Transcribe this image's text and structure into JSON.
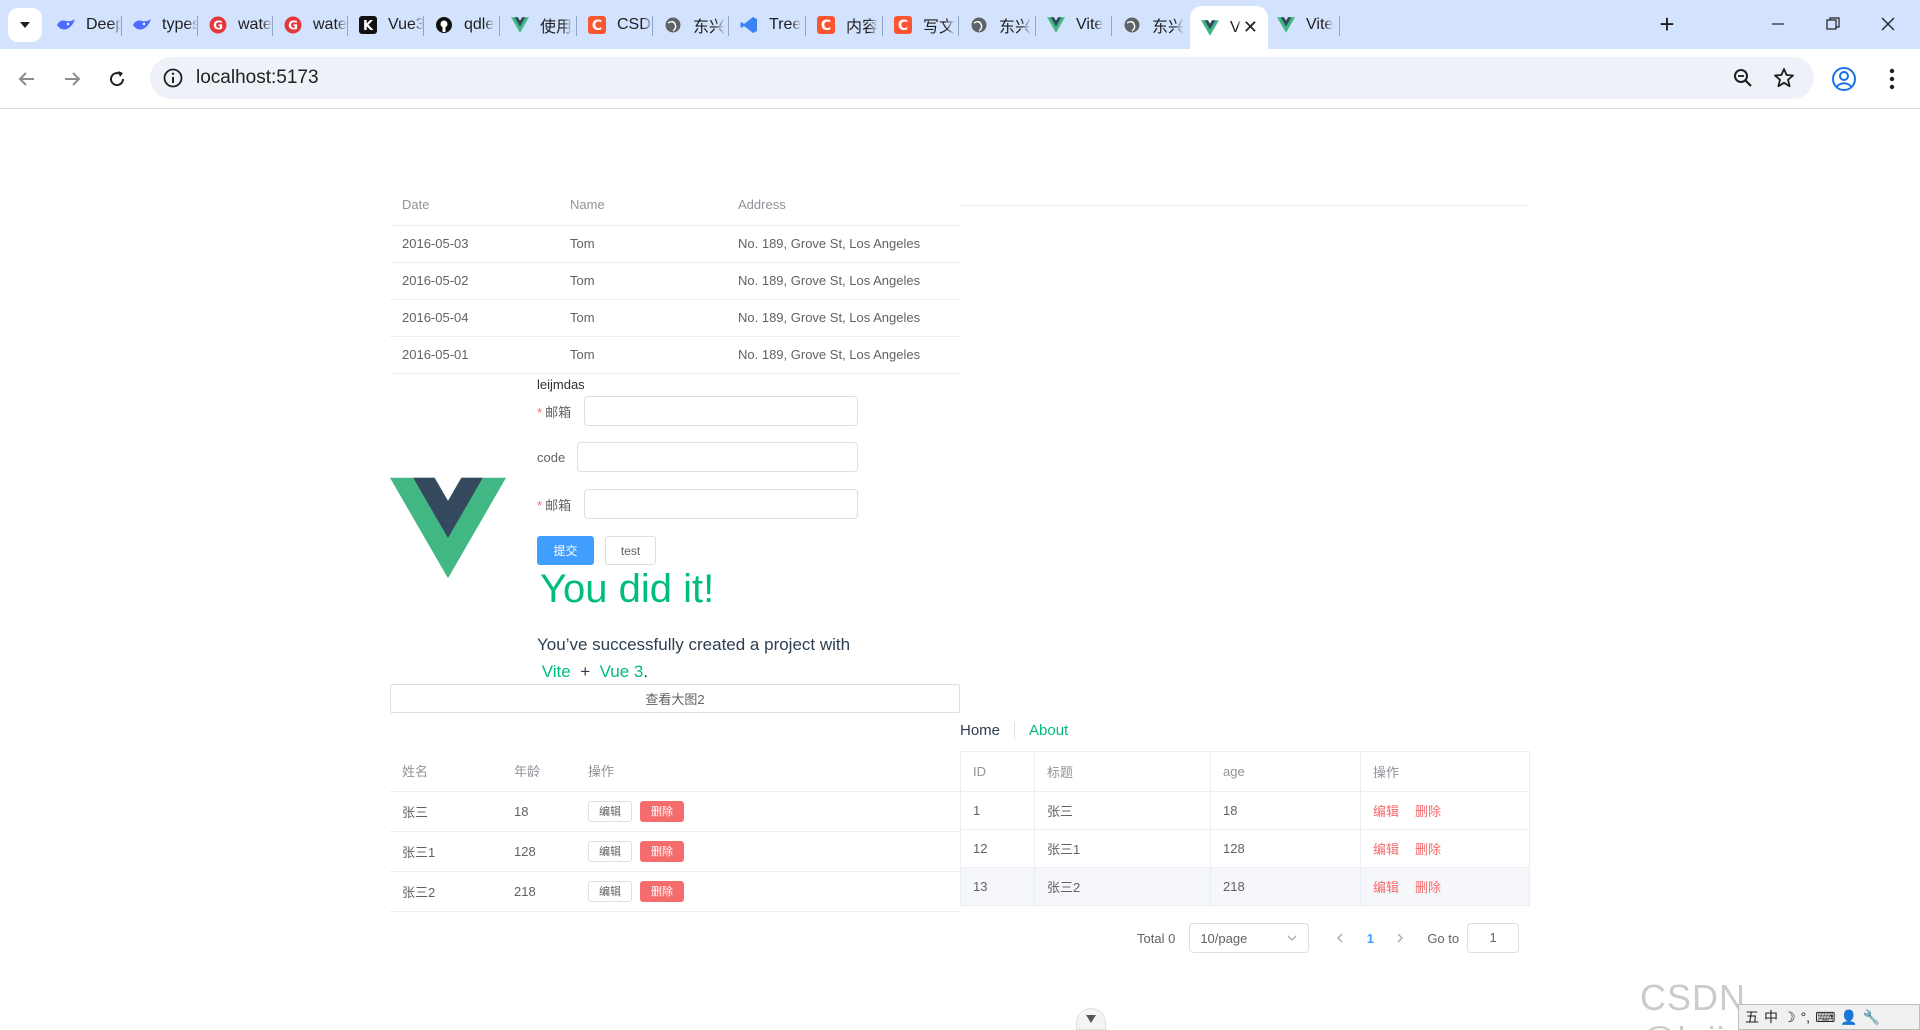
{
  "browser": {
    "tabs": [
      {
        "label": "Deep",
        "icon": "deepseek-icon",
        "color": "#4d6bfe"
      },
      {
        "label": "types",
        "icon": "deepseek-icon",
        "color": "#4d6bfe"
      },
      {
        "label": "wate",
        "icon": "g-logo-icon",
        "color": "#e4393c"
      },
      {
        "label": "wate",
        "icon": "g-logo-icon",
        "color": "#e4393c"
      },
      {
        "label": "Vue3",
        "icon": "k-logo-icon",
        "color": "#111111"
      },
      {
        "label": "qdle",
        "icon": "github-icon",
        "color": "#111111"
      },
      {
        "label": "使用",
        "icon": "vue-icon",
        "color": "#42b883"
      },
      {
        "label": "CSDI",
        "icon": "csdn-icon",
        "color": "#fc5531"
      },
      {
        "label": "东兴",
        "icon": "globe-icon",
        "color": "#5f6368"
      },
      {
        "label": "Tree",
        "icon": "vscode-icon",
        "color": "#3b82f6"
      },
      {
        "label": "内容",
        "icon": "csdn-icon",
        "color": "#fc5531"
      },
      {
        "label": "写文",
        "icon": "csdn-icon",
        "color": "#fc5531"
      },
      {
        "label": "东兴",
        "icon": "globe-icon",
        "color": "#5f6368"
      },
      {
        "label": "Vite",
        "icon": "vue-icon",
        "color": "#42b883"
      },
      {
        "label": "东兴",
        "icon": "globe-icon",
        "color": "#5f6368"
      },
      {
        "label": "V",
        "icon": "vue-icon",
        "color": "#42b883",
        "active": true
      },
      {
        "label": "Vite",
        "icon": "vue-icon",
        "color": "#42b883"
      }
    ],
    "tab_close": "✕",
    "new_tab": "+",
    "url": "localhost:5173"
  },
  "table1": {
    "headers": [
      "Date",
      "Name",
      "Address"
    ],
    "rows": [
      [
        "2016-05-03",
        "Tom",
        "No. 189, Grove St, Los Angeles"
      ],
      [
        "2016-05-02",
        "Tom",
        "No. 189, Grove St, Los Angeles"
      ],
      [
        "2016-05-04",
        "Tom",
        "No. 189, Grove St, Los Angeles"
      ],
      [
        "2016-05-01",
        "Tom",
        "No. 189, Grove St, Los Angeles"
      ]
    ]
  },
  "form": {
    "title": "leijmdas",
    "email_label": "邮箱",
    "code_label": "code",
    "email2_label": "邮箱",
    "required_mark": "*",
    "submit_label": "提交",
    "test_label": "test"
  },
  "hero": {
    "title": "You did it!",
    "sub_prefix": "You’ve successfully created a project with",
    "link_vite": "Vite",
    "plus": "+",
    "link_vue": "Vue 3",
    "period": "."
  },
  "wide_button_label": "查看大图2",
  "nav": {
    "home": "Home",
    "about": "About"
  },
  "table2": {
    "headers": [
      "姓名",
      "年龄",
      "操作"
    ],
    "edit_label": "编辑",
    "delete_label": "删除",
    "rows": [
      [
        "张三",
        "18"
      ],
      [
        "张三1",
        "128"
      ],
      [
        "张三2",
        "218"
      ]
    ]
  },
  "table3": {
    "headers": [
      "ID",
      "标题",
      "age",
      "操作"
    ],
    "edit_label": "编辑",
    "delete_label": "删除",
    "rows": [
      [
        "1",
        "张三",
        "18"
      ],
      [
        "12",
        "张三1",
        "128"
      ],
      [
        "13",
        "张三2",
        "218"
      ]
    ]
  },
  "pagination": {
    "total": "Total 0",
    "page_size": "10/page",
    "current_page": "1",
    "goto_label": "Go to",
    "goto_value": "1"
  },
  "watermark": "CSDN @leijmdas",
  "ime": {
    "items": [
      "五",
      "中",
      "☽",
      "°,",
      "⌨",
      "👤",
      "🔧"
    ]
  },
  "colors": {
    "primary": "#409eff",
    "danger": "#f56c6c",
    "vue_green": "#42b883",
    "vue_dark": "#35495e"
  }
}
